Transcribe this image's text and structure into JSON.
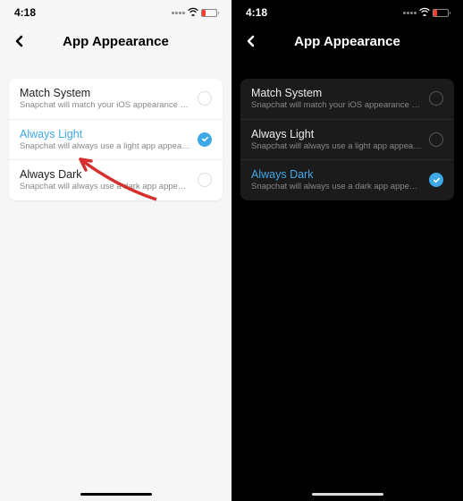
{
  "status": {
    "time": "4:18"
  },
  "header": {
    "title": "App Appearance"
  },
  "options": [
    {
      "label": "Match System",
      "desc": "Snapchat will match your iOS appearance settings."
    },
    {
      "label": "Always Light",
      "desc": "Snapchat will always use a light app appearance."
    },
    {
      "label": "Always Dark",
      "desc": "Snapchat will always use a dark app appearance."
    }
  ],
  "panes": {
    "light": {
      "selectedIndex": 1
    },
    "dark": {
      "selectedIndex": 2
    }
  },
  "colors": {
    "accent": "#3ea9e8",
    "battery_low": "#ff3b30"
  }
}
